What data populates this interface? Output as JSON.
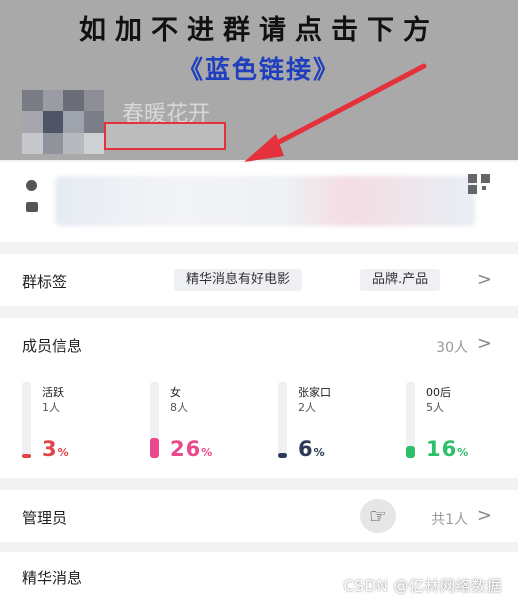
{
  "header": {
    "banner": "如加不进群请点击下方",
    "sub_banner": "《蓝色链接》",
    "group_name": "春暖花开"
  },
  "info": {
    "icons": [
      "clock-icon",
      "document-icon",
      "qr-code-icon"
    ]
  },
  "tags_row": {
    "title": "群标签",
    "tags": [
      "精华消息有好电影",
      "品牌.产品"
    ],
    "chevron": ">"
  },
  "members": {
    "title": "成员信息",
    "count": "30人",
    "chevron": ">",
    "stats": [
      {
        "label": "活跃",
        "sub": "1人",
        "pct": "3",
        "unit": "%",
        "level": 0.03,
        "color": "#e0454a"
      },
      {
        "label": "女",
        "sub": "8人",
        "pct": "26",
        "unit": "%",
        "level": 0.26,
        "color": "#e84a8c"
      },
      {
        "label": "张家口",
        "sub": "2人",
        "pct": "6",
        "unit": "%",
        "level": 0.06,
        "color": "#2b3a55"
      },
      {
        "label": "00后",
        "sub": "5人",
        "pct": "16",
        "unit": "%",
        "level": 0.16,
        "color": "#2fbf6a"
      }
    ]
  },
  "admin_row": {
    "title": "管理员",
    "count": "共1人",
    "chevron": ">",
    "icon": "hand-pointing-icon"
  },
  "digest_row": {
    "title": "精华消息"
  },
  "watermark": "CSDN @亿林网络数据",
  "colors": {
    "header_bg": "#a9a9a9",
    "link_blue": "#1f3fbf",
    "arrow_red": "#e4313b"
  }
}
